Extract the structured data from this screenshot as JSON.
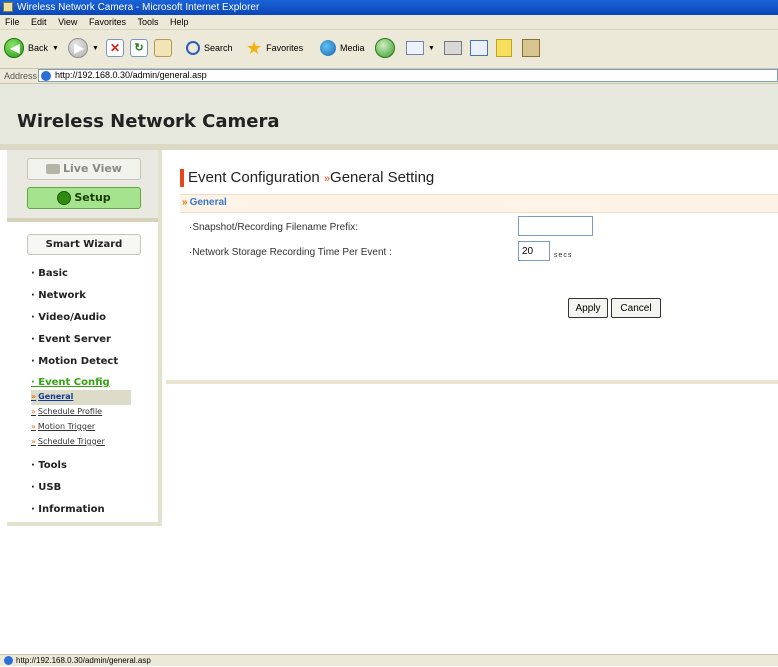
{
  "window": {
    "title": "Wireless Network Camera - Microsoft Internet Explorer"
  },
  "menubar": [
    "File",
    "Edit",
    "View",
    "Favorites",
    "Tools",
    "Help"
  ],
  "toolbar": {
    "back_label": "Back",
    "search_label": "Search",
    "favorites_label": "Favorites",
    "media_label": "Media"
  },
  "address": {
    "label": "Address",
    "url": "http://192.168.0.30/admin/general.asp"
  },
  "header": {
    "title": "Wireless Network Camera"
  },
  "sidebar": {
    "live_view": "Live View",
    "setup": "Setup",
    "smart_wizard": "Smart Wizard",
    "items": [
      {
        "label": "Basic"
      },
      {
        "label": "Network"
      },
      {
        "label": "Video/Audio"
      },
      {
        "label": "Event Server"
      },
      {
        "label": "Motion Detect"
      },
      {
        "label": "Event Config"
      },
      {
        "label": "Tools"
      },
      {
        "label": "USB"
      },
      {
        "label": "Information"
      }
    ],
    "sub_items": [
      {
        "label": "General"
      },
      {
        "label": "Schedule Profile"
      },
      {
        "label": "Motion Trigger"
      },
      {
        "label": "Schedule Trigger"
      }
    ]
  },
  "main": {
    "title": "Event Configuration",
    "subtitle": "General Setting",
    "section": "General",
    "fields": {
      "prefix_label": "·Snapshot/Recording Filename Prefix:",
      "prefix_value": "",
      "time_label": "·Network Storage Recording Time Per Event :",
      "time_value": "20",
      "time_unit": "secs"
    },
    "apply": "Apply",
    "cancel": "Cancel"
  },
  "status": {
    "text": "http://192.168.0.30/admin/general.asp"
  }
}
